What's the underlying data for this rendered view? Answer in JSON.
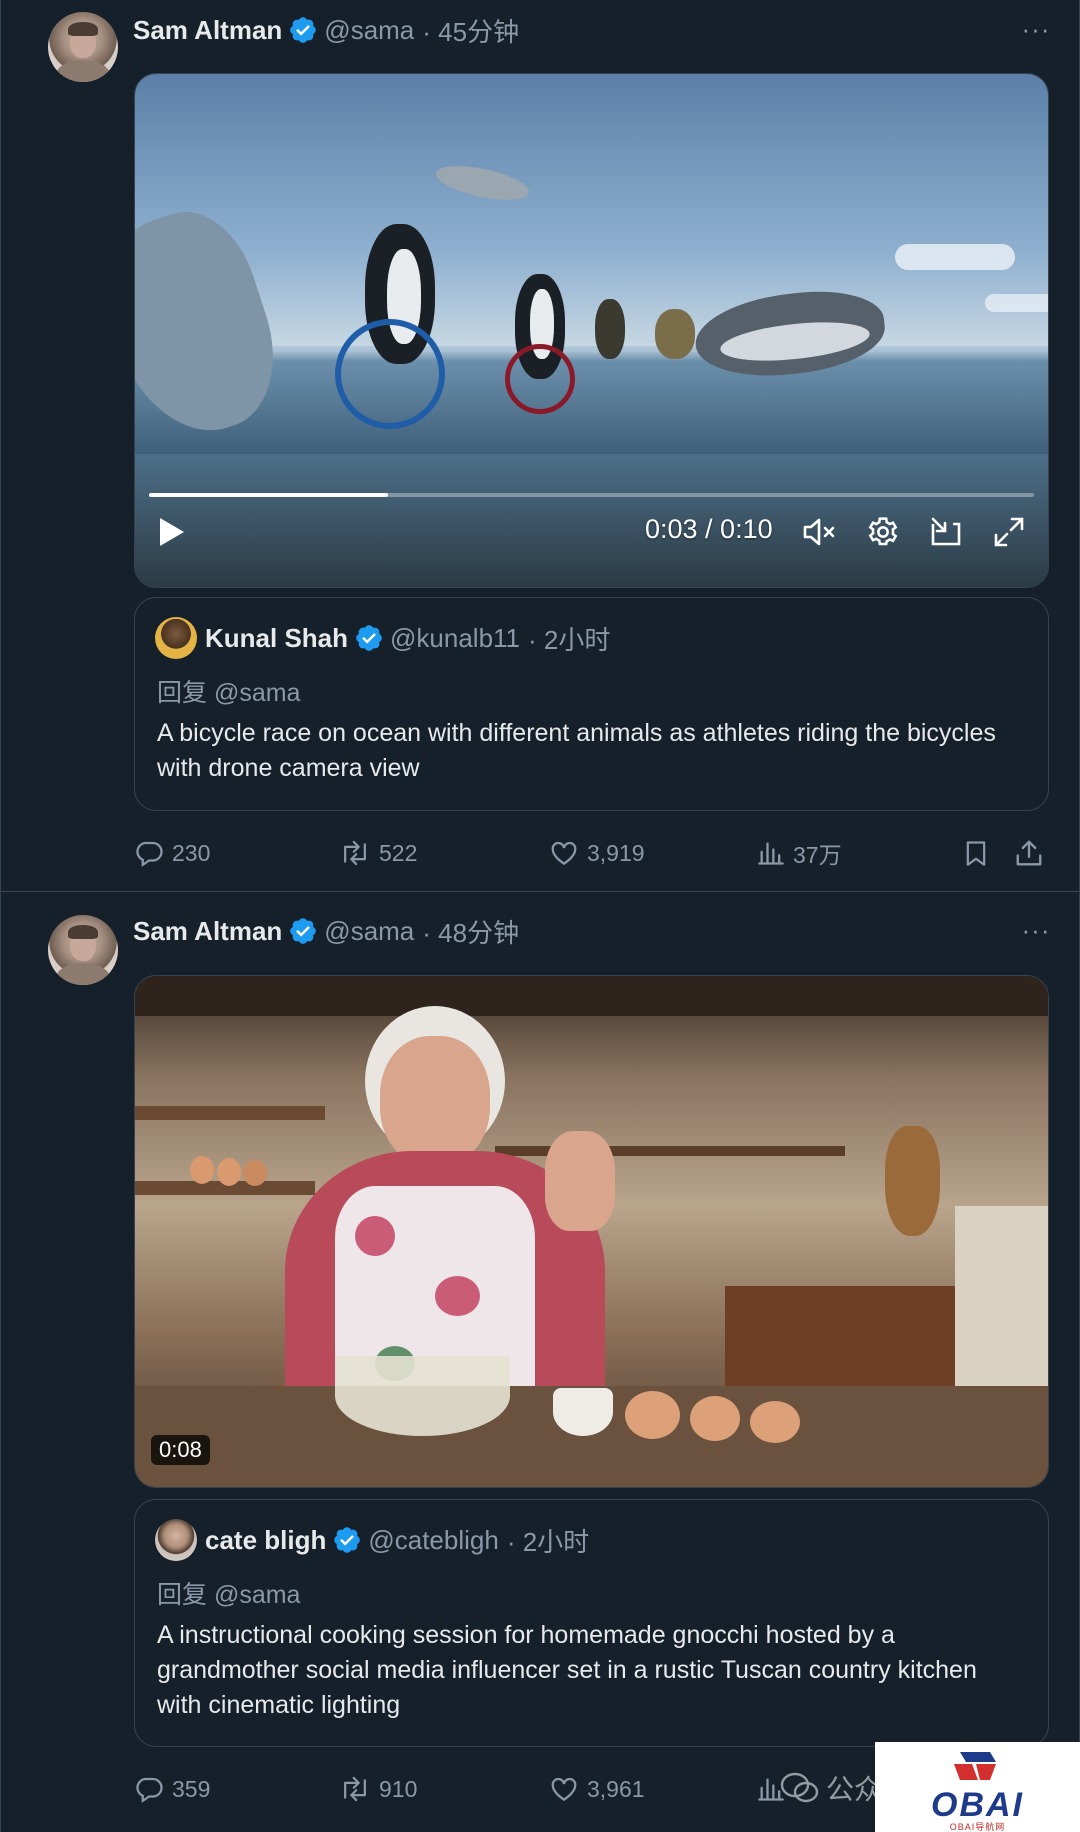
{
  "tweets": [
    {
      "author": {
        "name": "Sam Altman",
        "handle": "@sama",
        "time": "· 45分钟"
      },
      "more": "···",
      "video": {
        "time_display": "0:03 / 0:10",
        "progress": 0.27
      },
      "quote": {
        "author": {
          "name": "Kunal Shah",
          "handle": "@kunalb11",
          "time": "· 2小时"
        },
        "reply_to": "回复 @sama",
        "text": "A bicycle race on ocean with different animals as athletes riding the bicycles with drone camera view"
      },
      "stats": {
        "replies": "230",
        "reposts": "522",
        "likes": "3,919",
        "views": "37万"
      }
    },
    {
      "author": {
        "name": "Sam Altman",
        "handle": "@sama",
        "time": "· 48分钟"
      },
      "more": "···",
      "video": {
        "duration_badge": "0:08"
      },
      "quote": {
        "author": {
          "name": "cate bligh",
          "handle": "@catebligh",
          "time": "· 2小时"
        },
        "reply_to": "回复 @sama",
        "text": "A instructional cooking session for homemade gnocchi hosted by a grandmother social media influencer set in a rustic Tuscan country kitchen with cinematic lighting"
      },
      "stats": {
        "replies": "359",
        "reposts": "910",
        "likes": "3,961"
      }
    }
  ],
  "watermark": {
    "wechat_text": "公众",
    "logo_text": "OBAI",
    "logo_sub": "OBAI导航网"
  },
  "colors": {
    "background": "#15202b",
    "text": "#e7e9ea",
    "muted": "#8b98a5",
    "verified": "#1d9bf0",
    "border": "#38444d"
  }
}
